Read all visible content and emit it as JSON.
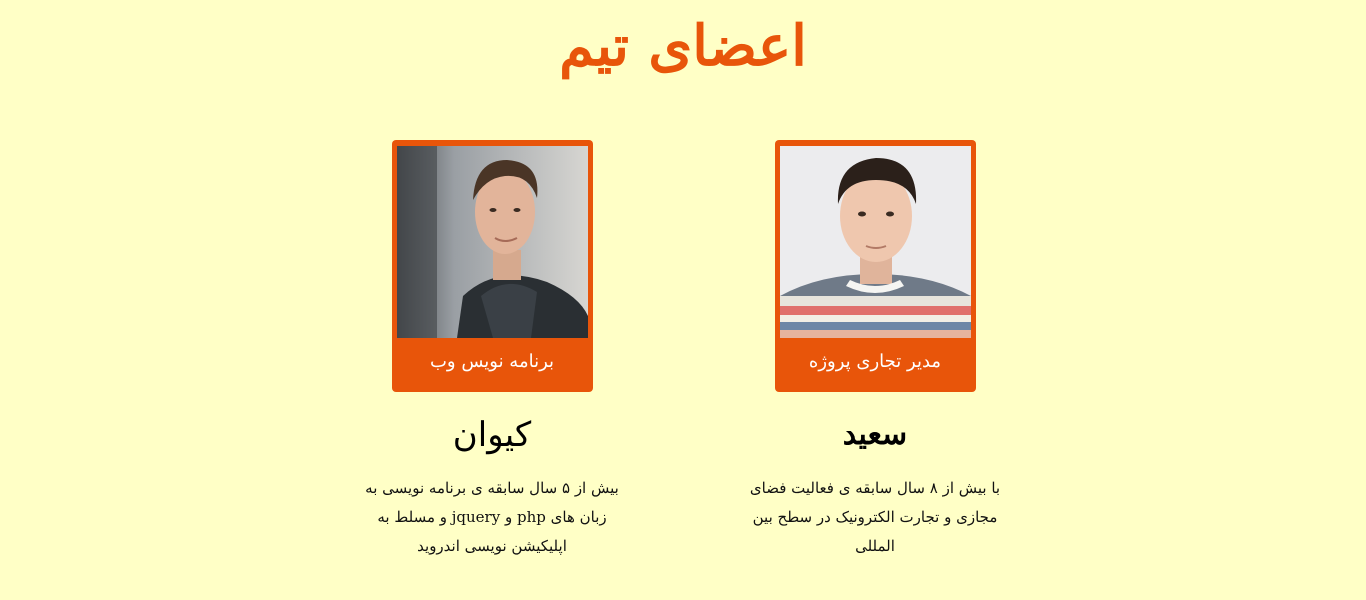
{
  "page": {
    "title": "اعضای تیم"
  },
  "members": [
    {
      "name": "سعید",
      "role": "مدیر تجاری پروژه",
      "bio": "با بیش از ۸ سال سابقه ی فعالیت فضای مجازی و تجارت الکترونیک در سطح بین المللی"
    },
    {
      "name": "کیوان",
      "role": "برنامه نویس وب",
      "bio": "بیش از ۵ سال سابقه ی برنامه نویسی به زبان های php و jquery و مسلط به اپلیکیشن نویسی اندروید"
    }
  ],
  "colors": {
    "background": "#ffffc6",
    "accent": "#e8550a"
  }
}
